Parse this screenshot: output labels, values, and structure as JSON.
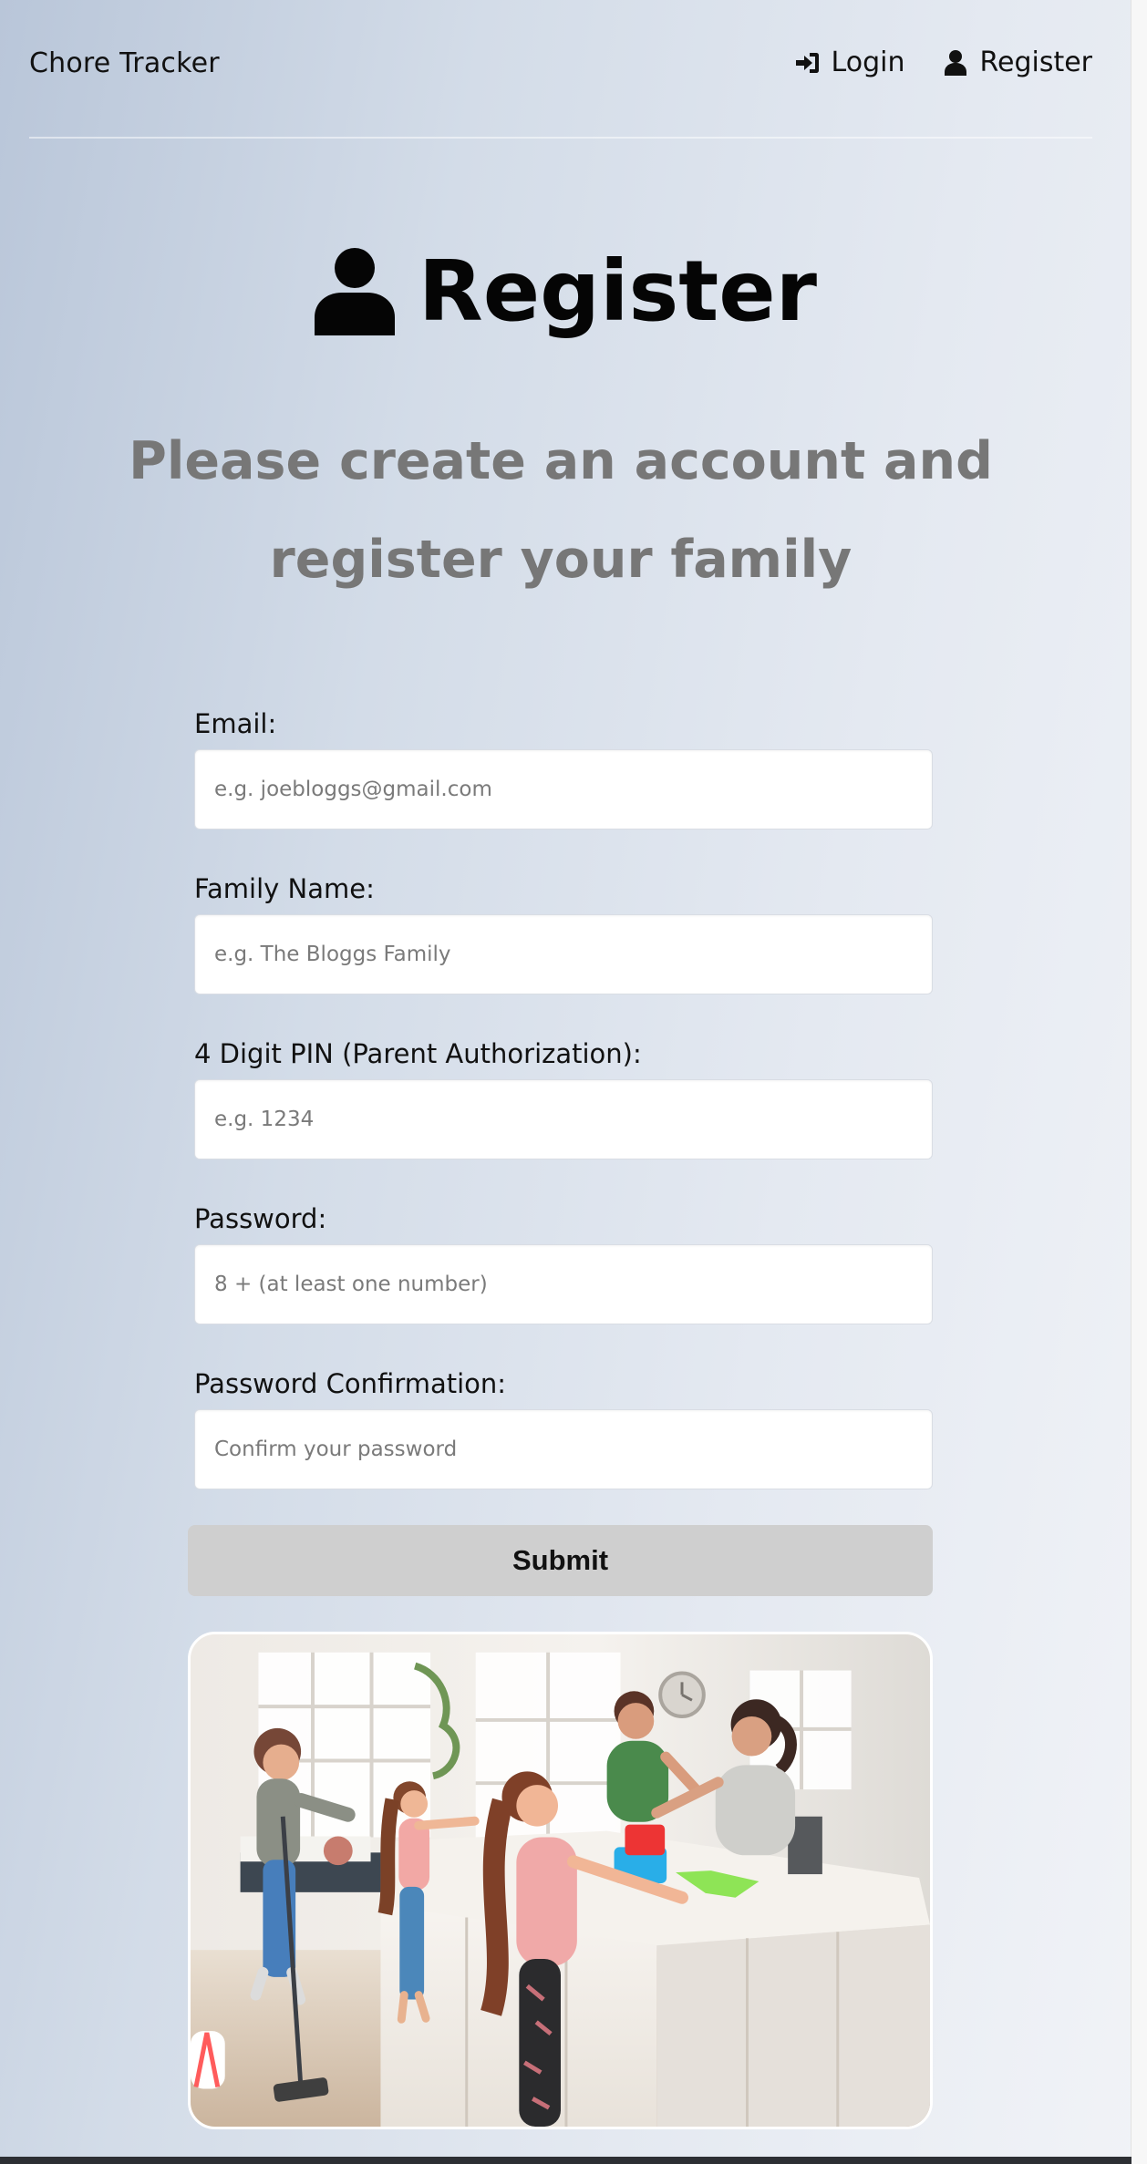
{
  "app": {
    "brand": "Chore Tracker"
  },
  "nav": {
    "login_label": "Login",
    "register_label": "Register",
    "login_icon": "sign-in-icon",
    "register_icon": "user-icon"
  },
  "hero": {
    "title": "Register",
    "icon": "user-icon",
    "subtitle": "Please create an account and register your family"
  },
  "form": {
    "fields": [
      {
        "label": "Email:",
        "placeholder": "e.g. joebloggs@gmail.com",
        "type": "email"
      },
      {
        "label": "Family Name:",
        "placeholder": "e.g. The Bloggs Family",
        "type": "text"
      },
      {
        "label": "4 Digit PIN (Parent Authorization):",
        "placeholder": "e.g. 1234",
        "type": "password"
      },
      {
        "label": "Password:",
        "placeholder": "8 + (at least one number)",
        "type": "password"
      },
      {
        "label": "Password Confirmation:",
        "placeholder": "Confirm your password",
        "type": "password"
      }
    ],
    "submit_label": "Submit"
  },
  "colors": {
    "page_gradient_start": "#b9c6d9",
    "page_gradient_end": "#f1f3f7",
    "subtitle": "#777777",
    "submit_background": "#cfcfcf",
    "input_background": "#ffffff"
  }
}
